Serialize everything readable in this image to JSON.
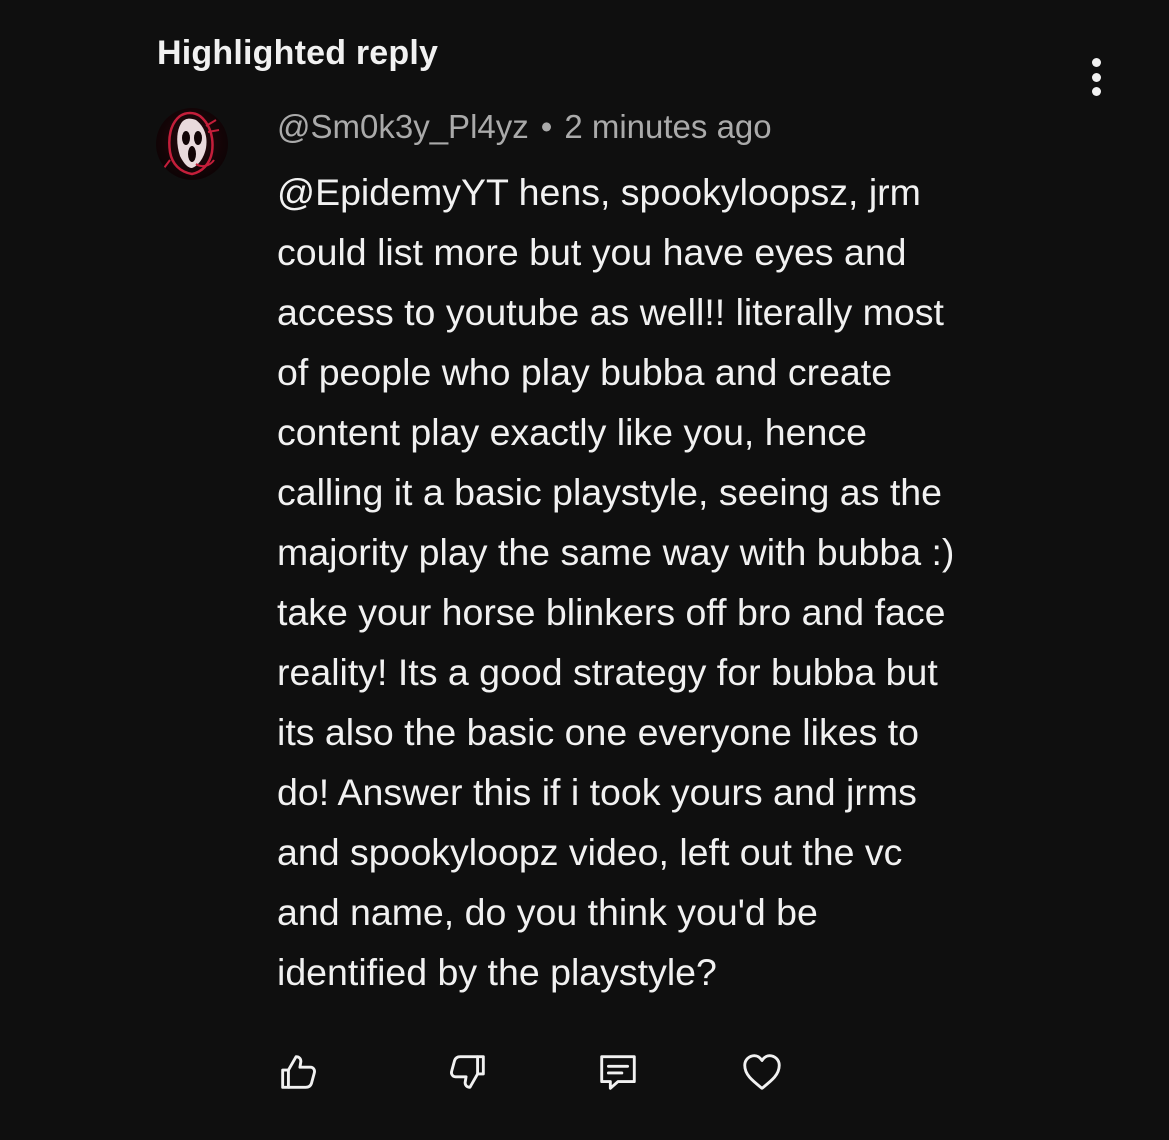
{
  "header": {
    "title": "Highlighted reply"
  },
  "comment": {
    "author": "@Sm0k3y_Pl4yz",
    "separator": "•",
    "timestamp": "2 minutes ago",
    "avatar_icon": "ghostface-avatar",
    "body": "@EpidemyYT hens, spookyloopsz, jrm\ncould list more but you have eyes and\naccess to youtube as well!! literally most\nof people who play bubba and create\ncontent play exactly like you, hence\ncalling it a basic playstyle, seeing as the\nmajority play the same way with bubba :)\ntake your horse blinkers off bro and face\nreality! Its a good strategy for bubba but\nits also the basic one everyone likes to\ndo! Answer this if i took yours and jrms\nand spookyloopz video, left out the vc\nand name, do you think you'd be\nidentified by the playstyle?"
  },
  "actions": {
    "like_icon": "thumbs-up-icon",
    "dislike_icon": "thumbs-down-icon",
    "reply_icon": "comment-icon",
    "heart_icon": "heart-icon",
    "more_icon": "more-vertical-icon"
  },
  "colors": {
    "background": "#0f0f0f",
    "text_primary": "#f1f1f1",
    "text_secondary": "#aaaaaa",
    "avatar_accent": "#c41e3a"
  }
}
